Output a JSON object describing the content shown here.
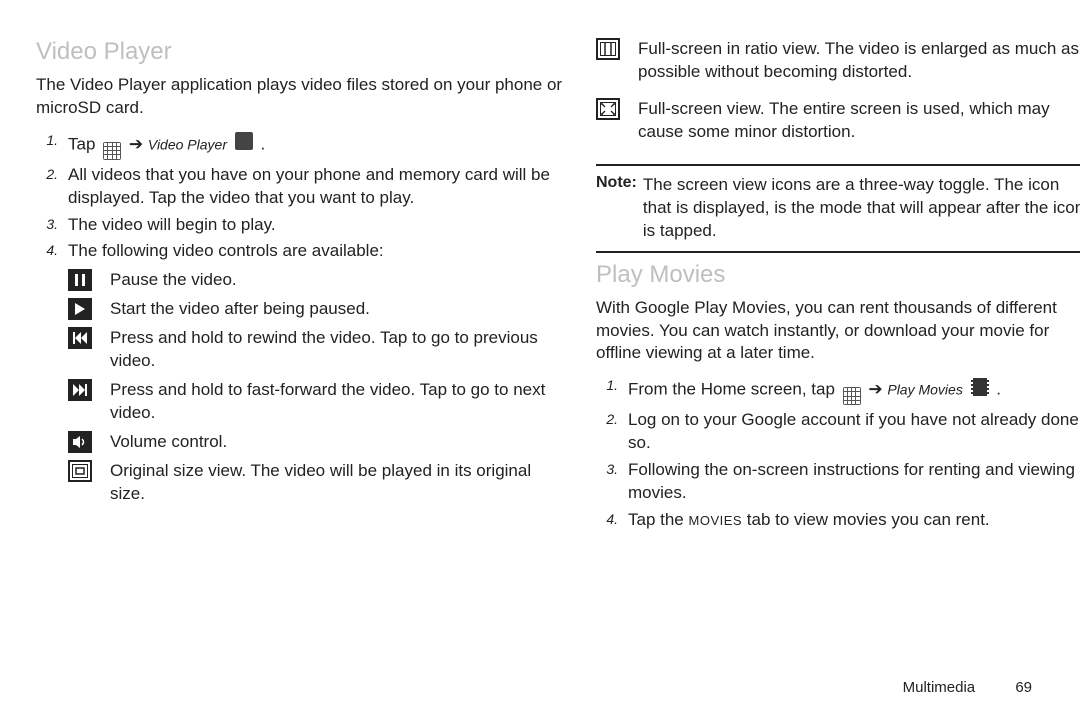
{
  "left": {
    "title": "Video Player",
    "intro": "The Video Player application plays video files stored on your phone or microSD card.",
    "step1_pre": "Tap",
    "step1_label": "Video Player",
    "step1_post": ".",
    "step2": "All videos that you have on your phone and memory card will be displayed. Tap the video that you want to play.",
    "step3": "The video will begin to play.",
    "step4": "The following video controls are available:",
    "controls": {
      "pause": "Pause the video.",
      "play": "Start the video after being paused.",
      "rewind": "Press and hold to rewind the video. Tap to go to previous video.",
      "ffwd": "Press and hold to fast-forward the video. Tap to go to next video.",
      "volume": "Volume control.",
      "original": "Original size view. The video will be played in its original size."
    }
  },
  "right": {
    "ratio": "Full-screen in ratio view. The video is enlarged as much as possible without becoming distorted.",
    "full": "Full-screen view. The entire screen is used, which may cause some minor distortion.",
    "note_label": "Note:",
    "note_text": "The screen view icons are a three-way toggle. The icon that is displayed, is the mode that will appear after the icon is tapped.",
    "pm_title": "Play Movies",
    "pm_intro": "With Google Play Movies, you can rent thousands of different movies. You can watch instantly, or download your movie for offline viewing at a later time.",
    "pm_step1_pre": "From the Home screen, tap",
    "pm_step1_label": "Play Movies",
    "pm_step1_post": ".",
    "pm_step2": "Log on to your Google account if you have not already done so.",
    "pm_step3": "Following the on-screen instructions for renting and viewing movies.",
    "pm_step4_pre": "Tap the ",
    "pm_step4_tab": "MOVIES",
    "pm_step4_post": " tab to view movies you can rent."
  },
  "footer": {
    "section": "Multimedia",
    "page": "69"
  }
}
